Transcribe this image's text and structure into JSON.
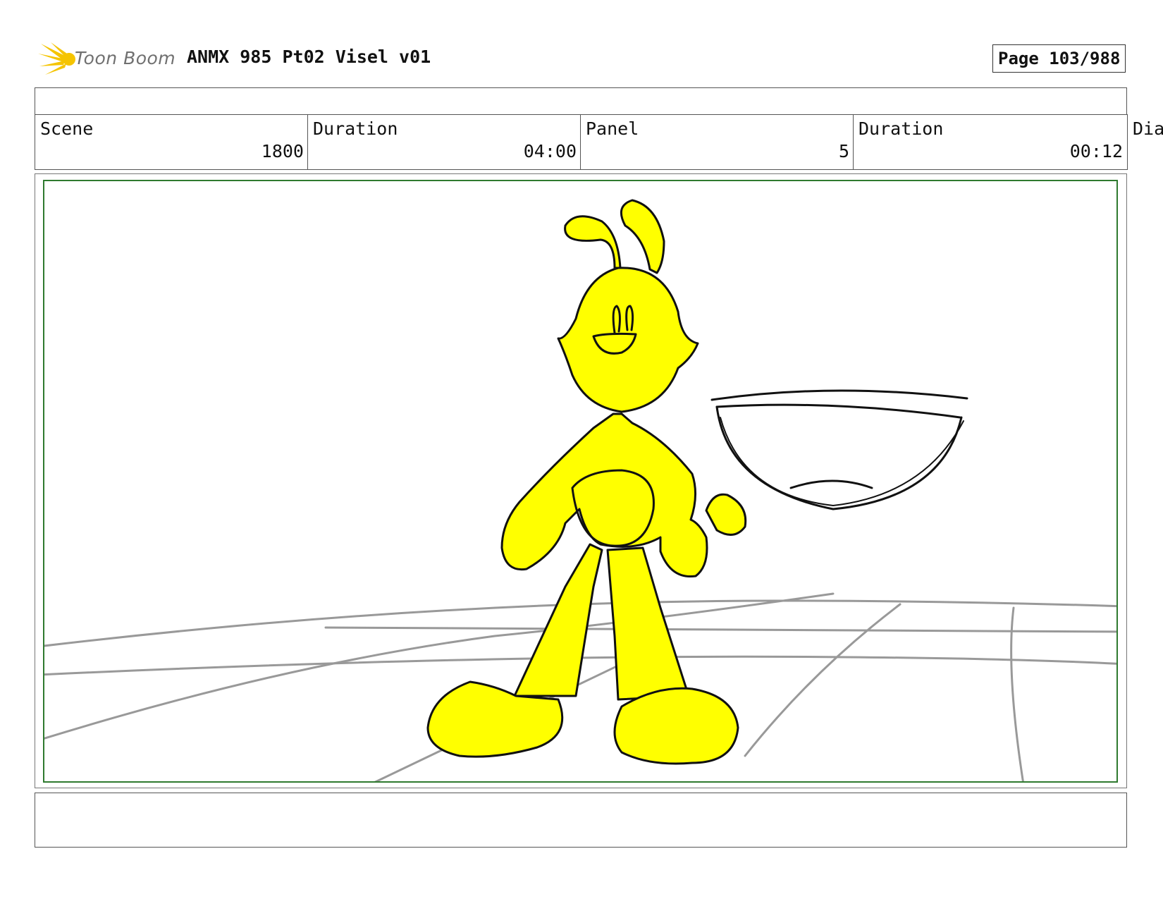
{
  "header": {
    "logo_text": "Toon Boom",
    "title": "ANMX 985 Pt02 Visel v01",
    "page": "Page 103/988"
  },
  "info": {
    "scene_label": "Scene",
    "scene_value": "1800",
    "scene_duration_label": "Duration",
    "scene_duration_value": "04:00",
    "panel_label": "Panel",
    "panel_value": "5",
    "panel_duration_label": "Duration",
    "panel_duration_value": "00:12",
    "dialogue_label": "Dia"
  },
  "colors": {
    "frame_border": "#2f7a2f",
    "character_fill": "#ffff00",
    "logo_accent": "#f5b800"
  }
}
